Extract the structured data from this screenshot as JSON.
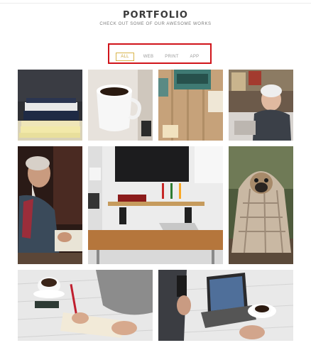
{
  "header": {
    "title": "PORTFOLIO",
    "subtitle": "CHECK OUT SOME OF OUR AWESOME WORKS"
  },
  "filters": [
    {
      "label": "ALL",
      "active": true
    },
    {
      "label": "WEB",
      "active": false
    },
    {
      "label": "PRINT",
      "active": false
    },
    {
      "label": "APP",
      "active": false
    }
  ],
  "colors": {
    "highlight_outline": "#d0141a",
    "active_filter": "#c9a43a"
  }
}
